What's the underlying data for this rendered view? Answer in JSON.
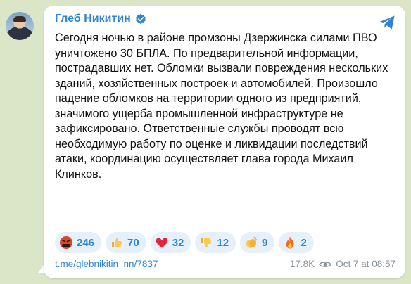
{
  "post": {
    "author": "Глеб Никитин",
    "text": "Сегодня ночью в районе промзоны Дзержинска силами ПВО уничтожено 30 БПЛА. По предварительной информации, пострадавших нет. Обломки вызвали повреждения нескольких зданий, хозяйственных построек и автомобилей. Произошло падение обломков на территории одного из предприятий, значимого ущерба промышленной инфраструктуре не зафиксировано. Ответственные службы проводят всю необходимую работу по оценке и ликвидации последствий атаки, координацию осуществляет глава города Михаил Клинков.",
    "link": "t.me/glebnikitin_nn/7837",
    "views": "17.8K",
    "timestamp": "Oct 7 at 08:57"
  },
  "reactions": [
    {
      "emoji": "angry-face-with-symbols",
      "count": "246"
    },
    {
      "emoji": "thumbs-up",
      "count": "70"
    },
    {
      "emoji": "red-heart",
      "count": "32"
    },
    {
      "emoji": "thumbs-down",
      "count": "12"
    },
    {
      "emoji": "clapping-hands",
      "count": "9"
    },
    {
      "emoji": "fire",
      "count": "2"
    }
  ],
  "colors": {
    "accent": "#2e84d0",
    "bubble": "#ffffff",
    "reaction_bg": "#e6f0fa",
    "background": "#dbe6c9"
  },
  "icons": {
    "verified": "verified-badge-icon",
    "share": "telegram-share-icon",
    "views": "eye-icon"
  }
}
